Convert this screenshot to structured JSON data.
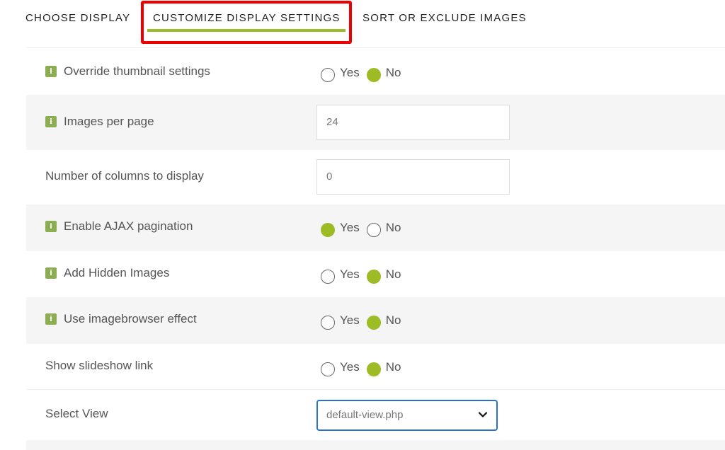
{
  "tabs": [
    {
      "label": "CHOOSE DISPLAY",
      "active": false
    },
    {
      "label": "CUSTOMIZE DISPLAY SETTINGS",
      "active": true
    },
    {
      "label": "SORT OR EXCLUDE IMAGES",
      "active": false
    }
  ],
  "colors": {
    "accent": "#9dbb24",
    "info_icon": "#8cad52",
    "highlight_box": "#ee0000",
    "select_focus": "#2b6fd6"
  },
  "settings": {
    "override_thumbnail": {
      "label": "Override thumbnail settings",
      "has_info": true,
      "options": [
        "Yes",
        "No"
      ],
      "selected": "No"
    },
    "images_per_page": {
      "label": "Images per page",
      "has_info": true,
      "value": "24"
    },
    "columns": {
      "label": "Number of columns to display",
      "has_info": false,
      "value": "0"
    },
    "ajax_pagination": {
      "label": "Enable AJAX pagination",
      "has_info": true,
      "options": [
        "Yes",
        "No"
      ],
      "selected": "Yes"
    },
    "hidden_images": {
      "label": "Add Hidden Images",
      "has_info": true,
      "options": [
        "Yes",
        "No"
      ],
      "selected": "No"
    },
    "imagebrowser": {
      "label": "Use imagebrowser effect",
      "has_info": true,
      "options": [
        "Yes",
        "No"
      ],
      "selected": "No"
    },
    "slideshow_link": {
      "label": "Show slideshow link",
      "has_info": false,
      "options": [
        "Yes",
        "No"
      ],
      "selected": "No"
    },
    "select_view": {
      "label": "Select View",
      "has_info": false,
      "value": "default-view.php"
    }
  },
  "icons": {
    "info": "i"
  }
}
